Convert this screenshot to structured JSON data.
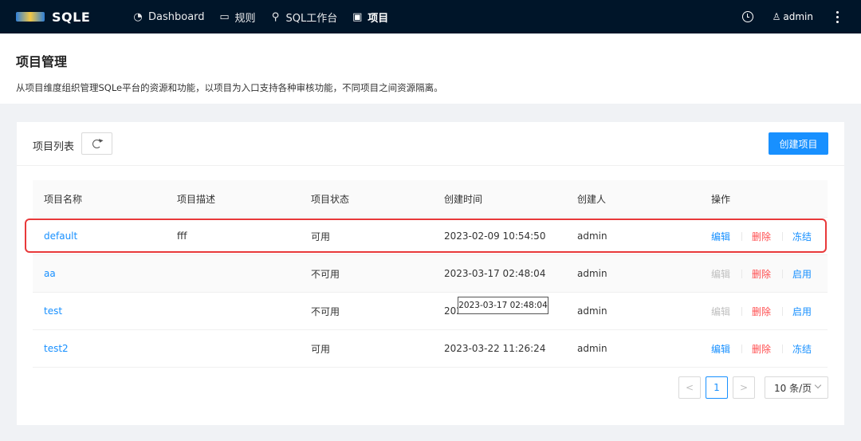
{
  "app": {
    "name": "SQLE"
  },
  "nav": {
    "items": [
      {
        "label": "Dashboard",
        "icon": "pie-chart-icon"
      },
      {
        "label": "规则",
        "icon": "monitor-icon"
      },
      {
        "label": "SQL工作台",
        "icon": "search-icon"
      },
      {
        "label": "项目",
        "icon": "project-icon"
      }
    ],
    "active": "项目",
    "user": "admin"
  },
  "page": {
    "title": "项目管理",
    "description": "从项目维度组织管理SQLe平台的资源和功能，以项目为入口支持各种审核功能，不同项目之间资源隔离。"
  },
  "card": {
    "title": "项目列表",
    "create_label": "创建项目"
  },
  "table": {
    "headers": [
      "项目名称",
      "项目描述",
      "项目状态",
      "创建时间",
      "创建人",
      "操作"
    ],
    "rows": [
      {
        "name": "default",
        "desc": "fff",
        "status": "可用",
        "created": "2023-02-09 10:54:50",
        "creator": "admin",
        "edit": "编辑",
        "delete": "删除",
        "toggle": "冻结",
        "edit_enabled": true
      },
      {
        "name": "aa",
        "desc": "",
        "status": "不可用",
        "created": "2023-03-17 02:48:04",
        "creator": "admin",
        "edit": "编辑",
        "delete": "删除",
        "toggle": "启用",
        "edit_enabled": false
      },
      {
        "name": "test",
        "desc": "",
        "status": "不可用",
        "created": "202",
        "creator": "admin",
        "edit": "编辑",
        "delete": "删除",
        "toggle": "启用",
        "edit_enabled": false
      },
      {
        "name": "test2",
        "desc": "",
        "status": "可用",
        "created": "2023-03-22 11:26:24",
        "creator": "admin",
        "edit": "编辑",
        "delete": "删除",
        "toggle": "冻结",
        "edit_enabled": true
      }
    ]
  },
  "tooltip": {
    "text": "2023-03-17 02:48:04"
  },
  "pagination": {
    "prev": "<",
    "next": ">",
    "current_page": "1",
    "page_size": "10 条/页"
  },
  "colors": {
    "nav_bg": "#001529",
    "primary": "#1890ff",
    "danger": "#ff4d4f",
    "highlight": "#e8393a"
  }
}
